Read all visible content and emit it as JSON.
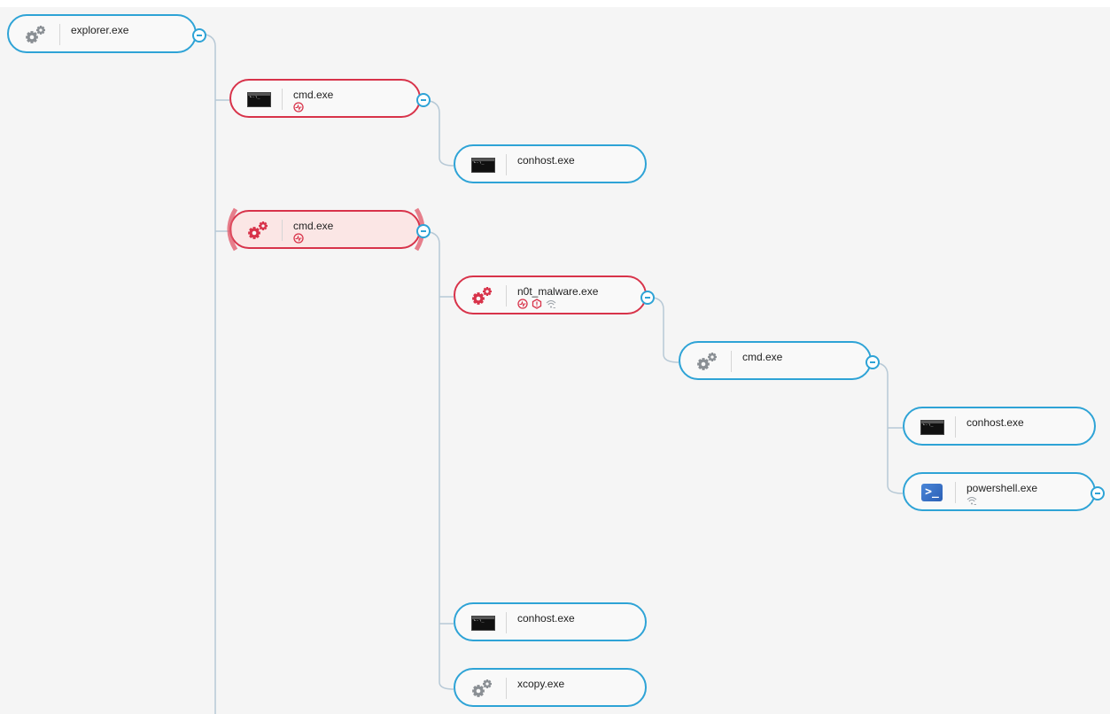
{
  "colors": {
    "edge": "#b7c9d6",
    "border_normal": "#2ea3d6",
    "border_alert": "#d8334a",
    "selected_fill": "#fbe6e5",
    "gear_gray": "#8a8f94",
    "gear_red": "#d8334a"
  },
  "process_tree": {
    "nodes": [
      {
        "label": "explorer.exe",
        "icon": "gear-gray-icon",
        "alert": false,
        "badges": []
      },
      {
        "label": "cmd.exe",
        "icon": "cmd-console-icon",
        "alert": true,
        "badges": [
          "activity-icon"
        ]
      },
      {
        "label": "conhost.exe",
        "icon": "cmd-console-icon",
        "alert": false,
        "badges": []
      },
      {
        "label": "cmd.exe",
        "icon": "gear-red-icon",
        "alert": true,
        "selected": true,
        "badges": [
          "activity-icon"
        ]
      },
      {
        "label": "n0t_malware.exe",
        "icon": "gear-red-icon",
        "alert": true,
        "badges": [
          "activity-icon",
          "shield-alert-icon",
          "network-icon"
        ]
      },
      {
        "label": "cmd.exe",
        "icon": "gear-gray-icon",
        "alert": false,
        "badges": []
      },
      {
        "label": "conhost.exe",
        "icon": "cmd-console-icon",
        "alert": false,
        "badges": []
      },
      {
        "label": "powershell.exe",
        "icon": "powershell-icon",
        "alert": false,
        "badges": [
          "network-icon"
        ]
      },
      {
        "label": "conhost.exe",
        "icon": "cmd-console-icon",
        "alert": false,
        "badges": []
      },
      {
        "label": "xcopy.exe",
        "icon": "gear-gray-icon",
        "alert": false,
        "badges": []
      }
    ]
  }
}
